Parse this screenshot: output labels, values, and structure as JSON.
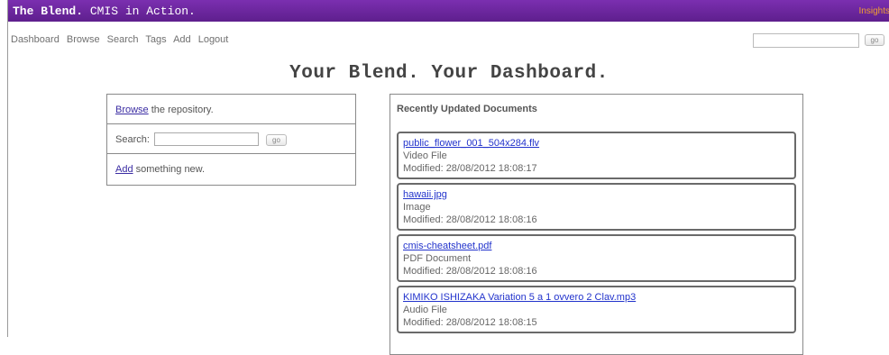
{
  "header": {
    "brand_bold": "The Blend.",
    "brand_rest": "CMIS in Action.",
    "right_link": "Insights"
  },
  "nav": {
    "items": [
      "Dashboard",
      "Browse",
      "Search",
      "Tags",
      "Add",
      "Logout"
    ],
    "search_value": "",
    "go_label": "go"
  },
  "page_title": "Your Blend. Your Dashboard.",
  "left_panel": {
    "browse_link": "Browse",
    "browse_rest": " the repository.",
    "search_label": "Search:",
    "search_value": "",
    "go_label": "go",
    "add_link": "Add",
    "add_rest": " something new."
  },
  "recent": {
    "title": "Recently Updated Documents",
    "documents": [
      {
        "name": "public_flower_001_504x284.flv",
        "type": "Video File",
        "modified": "Modified: 28/08/2012 18:08:17"
      },
      {
        "name": "hawaii.jpg",
        "type": "Image",
        "modified": "Modified: 28/08/2012 18:08:16"
      },
      {
        "name": "cmis-cheatsheet.pdf",
        "type": "PDF Document",
        "modified": "Modified: 28/08/2012 18:08:16"
      },
      {
        "name": "KIMIKO ISHIZAKA Variation 5 a 1 ovvero 2 Clav.mp3",
        "type": "Audio File",
        "modified": "Modified: 28/08/2012 18:08:15"
      }
    ]
  },
  "colors": {
    "header_bg": "#6a25a0",
    "link": "#2233cc",
    "insights": "#f0a030"
  }
}
